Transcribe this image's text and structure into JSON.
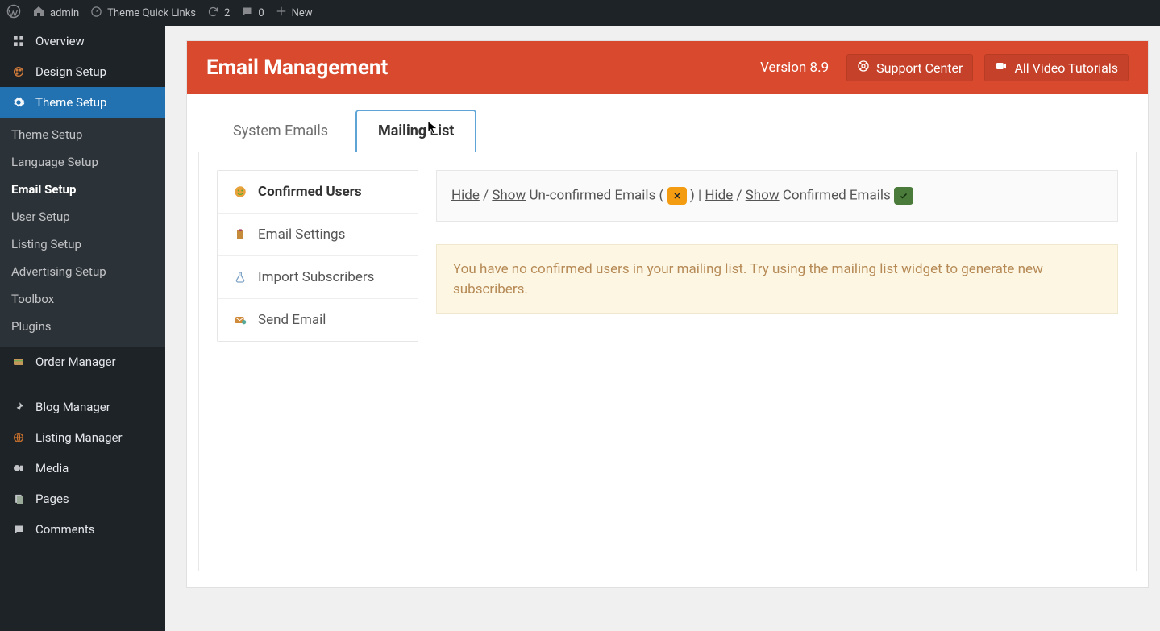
{
  "adminbar": {
    "site_name": "admin",
    "theme_quick_links": "Theme Quick Links",
    "updates_count": "2",
    "comments_count": "0",
    "new_label": "New"
  },
  "sidebar": {
    "items": [
      {
        "label": "Overview"
      },
      {
        "label": "Design Setup"
      },
      {
        "label": "Theme Setup"
      },
      {
        "label": "Order Manager"
      },
      {
        "label": "Blog Manager"
      },
      {
        "label": "Listing Manager"
      },
      {
        "label": "Media"
      },
      {
        "label": "Pages"
      },
      {
        "label": "Comments"
      }
    ],
    "submenu": [
      {
        "label": "Theme Setup"
      },
      {
        "label": "Language Setup"
      },
      {
        "label": "Email Setup"
      },
      {
        "label": "User Setup"
      },
      {
        "label": "Listing Setup"
      },
      {
        "label": "Advertising Setup"
      },
      {
        "label": "Toolbox"
      },
      {
        "label": "Plugins"
      }
    ]
  },
  "page": {
    "title": "Email Management",
    "version": "Version 8.9",
    "support_btn": "Support Center",
    "tutorials_btn": "All Video Tutorials"
  },
  "tabs": {
    "system_emails": "System Emails",
    "mailing_list": "Mailing List"
  },
  "mailing_sidebar": {
    "confirmed_users": "Confirmed Users",
    "email_settings": "Email Settings",
    "import_subs": "Import Subscribers",
    "send_email": "Send Email"
  },
  "filterbar": {
    "hide1": "Hide",
    "show1": "Show",
    "text1": " Un-confirmed Emails (",
    "pipe": ") | ",
    "hide2": "Hide",
    "show2": "Show",
    "text2": " Confirmed Emails "
  },
  "notice": {
    "text": "You have no confirmed users in your mailing list. Try using the mailing list widget to generate new subscribers."
  }
}
